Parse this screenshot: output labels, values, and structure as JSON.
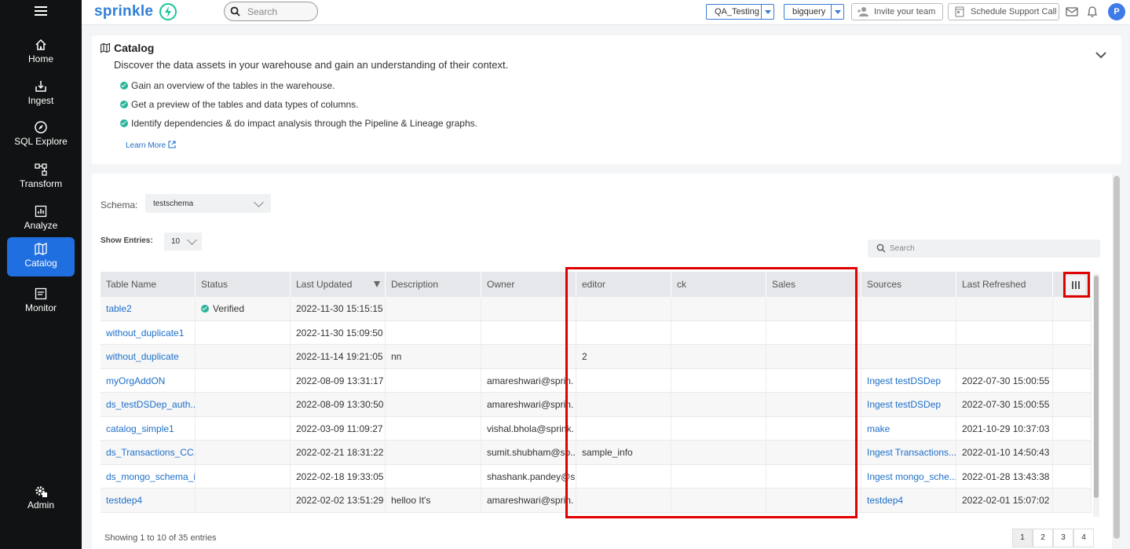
{
  "sidebar": {
    "items": [
      {
        "label": "Home",
        "icon": "home-icon"
      },
      {
        "label": "Ingest",
        "icon": "ingest-icon"
      },
      {
        "label": "SQL Explore",
        "icon": "compass-icon"
      },
      {
        "label": "Transform",
        "icon": "transform-icon"
      },
      {
        "label": "Analyze",
        "icon": "analyze-icon"
      },
      {
        "label": "Catalog",
        "icon": "map-icon",
        "active": true
      },
      {
        "label": "Monitor",
        "icon": "monitor-icon"
      },
      {
        "label": "Admin",
        "icon": "admin-gear-icon"
      }
    ]
  },
  "header": {
    "logo": "sprinkle",
    "search_placeholder": "Search",
    "workspace": "QA_Testing",
    "warehouse": "bigquery",
    "invite_label": "Invite your team",
    "schedule_label": "Schedule Support Call",
    "avatar_initial": "P"
  },
  "info": {
    "title": "Catalog",
    "description": "Discover the data assets in your warehouse and gain an understanding of their context.",
    "bullets": [
      "Gain an overview of the tables in the warehouse.",
      "Get a preview of the tables and data types of columns.",
      "Identify dependencies & do impact analysis through the Pipeline & Lineage graphs."
    ],
    "learn_more": "Learn More"
  },
  "catalog": {
    "schema_label": "Schema:",
    "schema_value": "testschema",
    "entries_label": "Show Entries:",
    "entries_value": "10",
    "search_placeholder": "Search",
    "columns": [
      "Table Name",
      "Status",
      "Last Updated",
      "Description",
      "Owner",
      "editor",
      "ck",
      "Sales",
      "Sources",
      "Last Refreshed"
    ],
    "rows": [
      {
        "name": "table2",
        "status": "Verified",
        "updated": "2022-11-30 15:15:15",
        "description": "",
        "owner": "",
        "editor": "",
        "ck": "",
        "sales": "",
        "sources": "",
        "refreshed": ""
      },
      {
        "name": "without_duplicate1",
        "status": "",
        "updated": "2022-11-30 15:09:50",
        "description": "",
        "owner": "",
        "editor": "",
        "ck": "",
        "sales": "",
        "sources": "",
        "refreshed": ""
      },
      {
        "name": "without_duplicate",
        "status": "",
        "updated": "2022-11-14 19:21:05",
        "description": "nn",
        "owner": "",
        "editor": "2",
        "ck": "",
        "sales": "",
        "sources": "",
        "refreshed": ""
      },
      {
        "name": "myOrgAddON",
        "status": "",
        "updated": "2022-08-09 13:31:17",
        "description": "",
        "owner": "amareshwari@sprin.",
        "editor": "",
        "ck": "",
        "sales": "",
        "sources": "Ingest testDSDep",
        "refreshed": "2022-07-30 15:00:55"
      },
      {
        "name": "ds_testDSDep_auth...",
        "status": "",
        "updated": "2022-08-09 13:30:50",
        "description": "",
        "owner": "amareshwari@sprin.",
        "editor": "",
        "ck": "",
        "sales": "",
        "sources": "Ingest testDSDep",
        "refreshed": "2022-07-30 15:00:55"
      },
      {
        "name": "catalog_simple1",
        "status": "",
        "updated": "2022-03-09 11:09:27",
        "description": "",
        "owner": "vishal.bhola@sprink.",
        "editor": "",
        "ck": "",
        "sales": "",
        "sources": "make",
        "refreshed": "2021-10-29 10:37:03"
      },
      {
        "name": "ds_Transactions_CC...",
        "status": "",
        "updated": "2022-02-21 18:31:22",
        "description": "",
        "owner": "sumit.shubham@sp...",
        "editor": "sample_info",
        "ck": "",
        "sales": "",
        "sources": "Ingest Transactions...",
        "refreshed": "2022-01-10 14:50:43"
      },
      {
        "name": "ds_mongo_schema_i...",
        "status": "",
        "updated": "2022-02-18 19:33:05",
        "description": "",
        "owner": "shashank.pandey@s...",
        "editor": "",
        "ck": "",
        "sales": "",
        "sources": "Ingest mongo_sche...",
        "refreshed": "2022-01-28 13:43:38"
      },
      {
        "name": "testdep4",
        "status": "",
        "updated": "2022-02-02 13:51:29",
        "description": "helloo It's",
        "owner": "amareshwari@sprin.",
        "editor": "",
        "ck": "",
        "sales": "",
        "sources": "testdep4",
        "refreshed": "2022-02-01 15:07:02"
      }
    ],
    "footer": "Showing 1 to 10 of 35 entries",
    "pages": [
      "1",
      "2",
      "3",
      "4"
    ],
    "highlight_color": "#e00000"
  }
}
